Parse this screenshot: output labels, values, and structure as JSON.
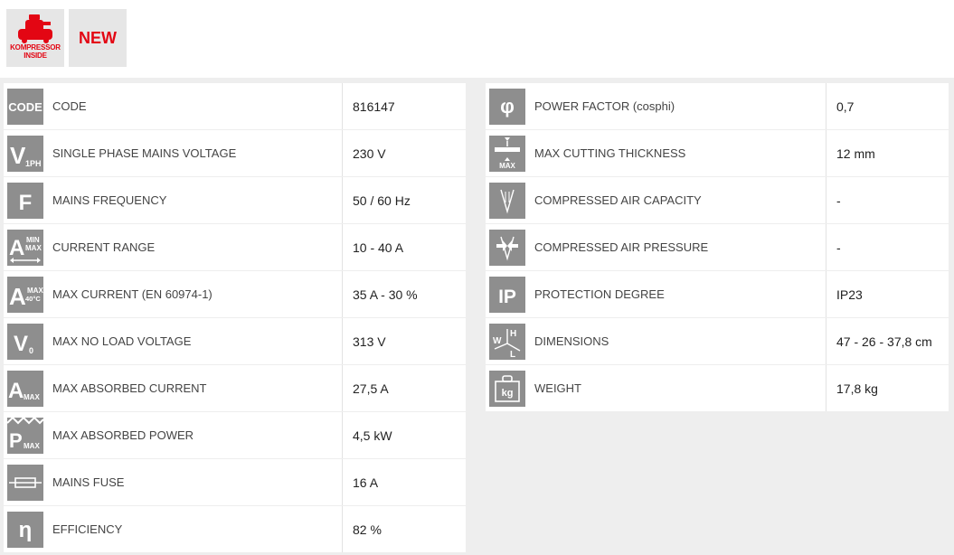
{
  "badges": {
    "kompressor_line1": "KOMPRESSOR",
    "kompressor_line2": "INSIDE",
    "new_label": "NEW"
  },
  "colors": {
    "accent": "#e30613",
    "icon_bg": "#8e8e8e",
    "panel_bg": "#eeeeee"
  },
  "left_specs": [
    {
      "icon": "code-icon",
      "label": "CODE",
      "value": "816147"
    },
    {
      "icon": "single-phase-voltage-icon",
      "label": "SINGLE PHASE MAINS VOLTAGE",
      "value": "230 V"
    },
    {
      "icon": "frequency-icon",
      "label": "MAINS FREQUENCY",
      "value": "50 / 60 Hz"
    },
    {
      "icon": "current-range-icon",
      "label": "CURRENT RANGE",
      "value": "10 - 40 A"
    },
    {
      "icon": "max-current-icon",
      "label": "MAX CURRENT (EN 60974-1)",
      "value": "35 A - 30 %"
    },
    {
      "icon": "no-load-voltage-icon",
      "label": "MAX NO LOAD VOLTAGE",
      "value": "313 V"
    },
    {
      "icon": "absorbed-current-icon",
      "label": "MAX ABSORBED CURRENT",
      "value": "27,5 A"
    },
    {
      "icon": "absorbed-power-icon",
      "label": "MAX ABSORBED POWER",
      "value": "4,5 kW"
    },
    {
      "icon": "fuse-icon",
      "label": "MAINS FUSE",
      "value": "16 A"
    },
    {
      "icon": "efficiency-icon",
      "label": "EFFICIENCY",
      "value": "82 %"
    }
  ],
  "right_specs": [
    {
      "icon": "power-factor-icon",
      "label": "POWER FACTOR (cosphi)",
      "value": "0,7"
    },
    {
      "icon": "cutting-thickness-icon",
      "label": "MAX CUTTING THICKNESS",
      "value": "12 mm"
    },
    {
      "icon": "air-capacity-icon",
      "label": "COMPRESSED AIR CAPACITY",
      "value": "-"
    },
    {
      "icon": "air-pressure-icon",
      "label": "COMPRESSED AIR PRESSURE",
      "value": "-"
    },
    {
      "icon": "protection-degree-icon",
      "label": "PROTECTION DEGREE",
      "value": "IP23"
    },
    {
      "icon": "dimensions-icon",
      "label": "DIMENSIONS",
      "value": "47 - 26 - 37,8 cm"
    },
    {
      "icon": "weight-icon",
      "label": "WEIGHT",
      "value": "17,8 kg"
    }
  ],
  "icon_glyphs": {
    "code": "CODE",
    "voltage_main": "V",
    "voltage_sub": "1PH",
    "frequency": "F",
    "amp": "A",
    "min": "MIN",
    "max": "MAX",
    "temp": "40°C",
    "v0_sub": "0",
    "power": "P",
    "eta": "η",
    "phi": "φ",
    "ip": "IP",
    "h": "H",
    "w": "W",
    "l": "L",
    "kg": "kg"
  }
}
